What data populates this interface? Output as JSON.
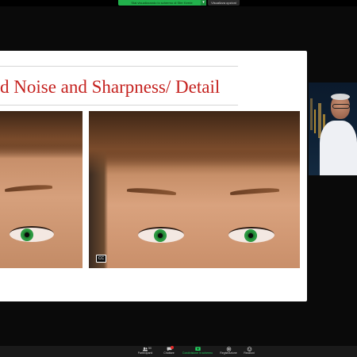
{
  "meeting": {
    "share_banner_text": "Stai visualizzando lo schermo di Sfer Kerrie",
    "view_options_label": "Visualizza opzioni"
  },
  "slide": {
    "title": "d Noise and Sharpness/ Detail",
    "title_color": "#c5221f"
  },
  "participant": {
    "video_icon": "person-video-tile"
  },
  "toolbar": {
    "participants_label": "Partecipanti",
    "participants_count": "50",
    "chat_label": "Chattare",
    "share_label": "Condivisione in schermo",
    "record_label": "Registrazione",
    "reactions_label": "Reazioni",
    "accent_color": "#23d160"
  }
}
